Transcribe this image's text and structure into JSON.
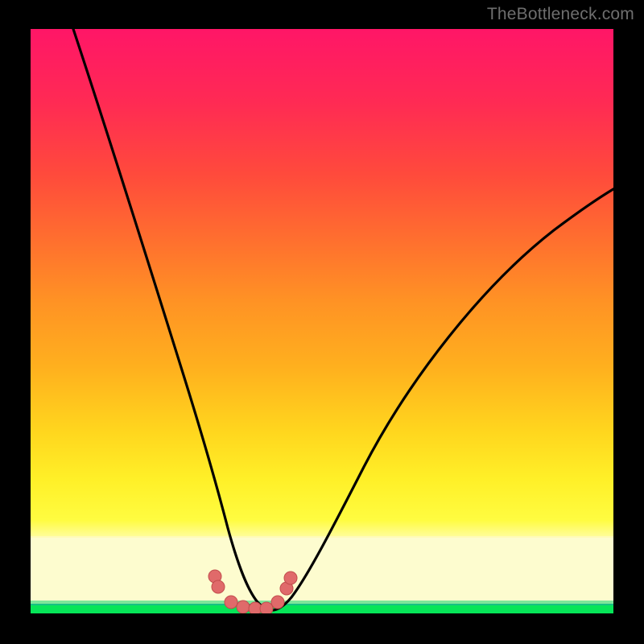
{
  "watermark": "TheBottleneck.com",
  "colors": {
    "frame": "#000000",
    "curve": "#000000",
    "marker_fill": "#e06a6a",
    "marker_stroke": "#c24d4d",
    "gradient_top": "#ff1667",
    "gradient_bottom": "#06e558"
  },
  "chart_data": {
    "type": "line",
    "title": "",
    "xlabel": "",
    "ylabel": "",
    "xlim": [
      0,
      100
    ],
    "ylim": [
      0,
      100
    ],
    "series": [
      {
        "name": "left-branch",
        "x": [
          6,
          10,
          14,
          18,
          22,
          26,
          28,
          30,
          31.5,
          33,
          34.5,
          36,
          37.5,
          39,
          40,
          40.8
        ],
        "y": [
          105,
          93,
          81,
          69,
          57,
          45,
          39,
          33,
          27,
          21,
          15.5,
          10,
          6,
          3,
          1.4,
          0.6
        ]
      },
      {
        "name": "right-branch",
        "x": [
          40.8,
          42,
          43.5,
          45,
          47,
          50,
          54,
          59,
          65,
          72,
          80,
          88,
          95,
          100
        ],
        "y": [
          0.6,
          1.6,
          3.4,
          6,
          9.8,
          15.8,
          23.5,
          32,
          41,
          50,
          58.5,
          65,
          70,
          73.5
        ]
      }
    ],
    "markers": {
      "name": "highlight-points",
      "x": [
        31.7,
        32.1,
        34.2,
        36.3,
        38.3,
        40.3,
        42.3,
        43.8,
        44.4
      ],
      "y": [
        6.2,
        4.5,
        1.9,
        1.0,
        0.8,
        0.9,
        1.9,
        4.2,
        6.0
      ]
    }
  }
}
